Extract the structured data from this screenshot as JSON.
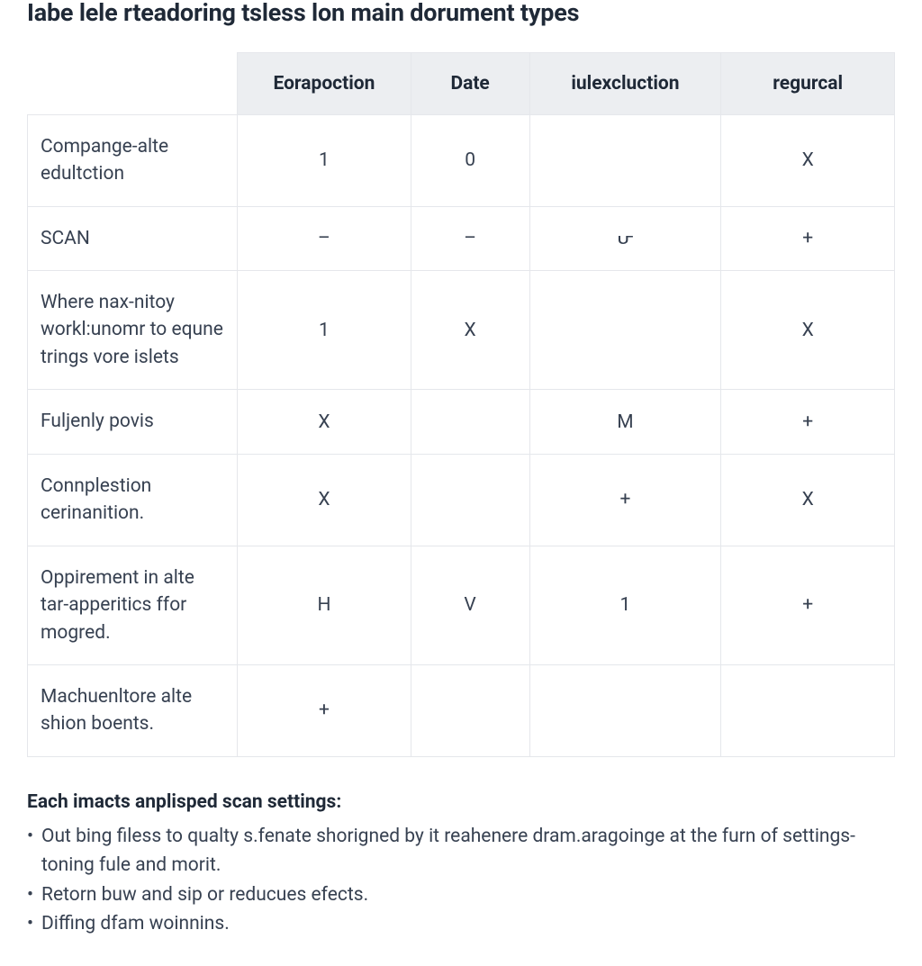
{
  "title": "Iabe lele rteadoring tsless lon main dorument types",
  "table": {
    "headers": [
      "Eorapoction",
      "Date",
      "iulexcluction",
      "regurcal"
    ],
    "rows": [
      {
        "label": "Compange-alte edultction",
        "c1": "1",
        "c2": "0",
        "c3": "",
        "c4": "X"
      },
      {
        "label": "SCAN",
        "c1": "–",
        "c2": "–",
        "c3": "ᕂ",
        "c4": "+"
      },
      {
        "label": "Where nax-nitoy workl:unomr to equne trings vore islets",
        "c1": "1",
        "c2": "X",
        "c3": "",
        "c4": "X"
      },
      {
        "label": "Fuljenly povis",
        "c1": "X",
        "c2": "",
        "c3": "M",
        "c4": "+"
      },
      {
        "label": "Connplestion cerinanition.",
        "c1": "X",
        "c2": "",
        "c3": "+",
        "c4": "X"
      },
      {
        "label": "Oppirement in alte tar-apperitics ffor mogred.",
        "c1": "H",
        "c2": "V",
        "c3": "1",
        "c4": "+"
      },
      {
        "label": "Machuenltore alte shion boents.",
        "c1": "+",
        "c2": "",
        "c3": "",
        "c4": ""
      }
    ]
  },
  "notes": {
    "heading": "Each imacts anplisped scan settings:",
    "items": [
      "Out bing filess to qualty s.fenate shorigned by it reahenere dram.aragoinge at the furn of settings-toning fule and morit.",
      "Retorn buw and sip or reducues efects.",
      "Diffing dfam woinnins."
    ]
  }
}
